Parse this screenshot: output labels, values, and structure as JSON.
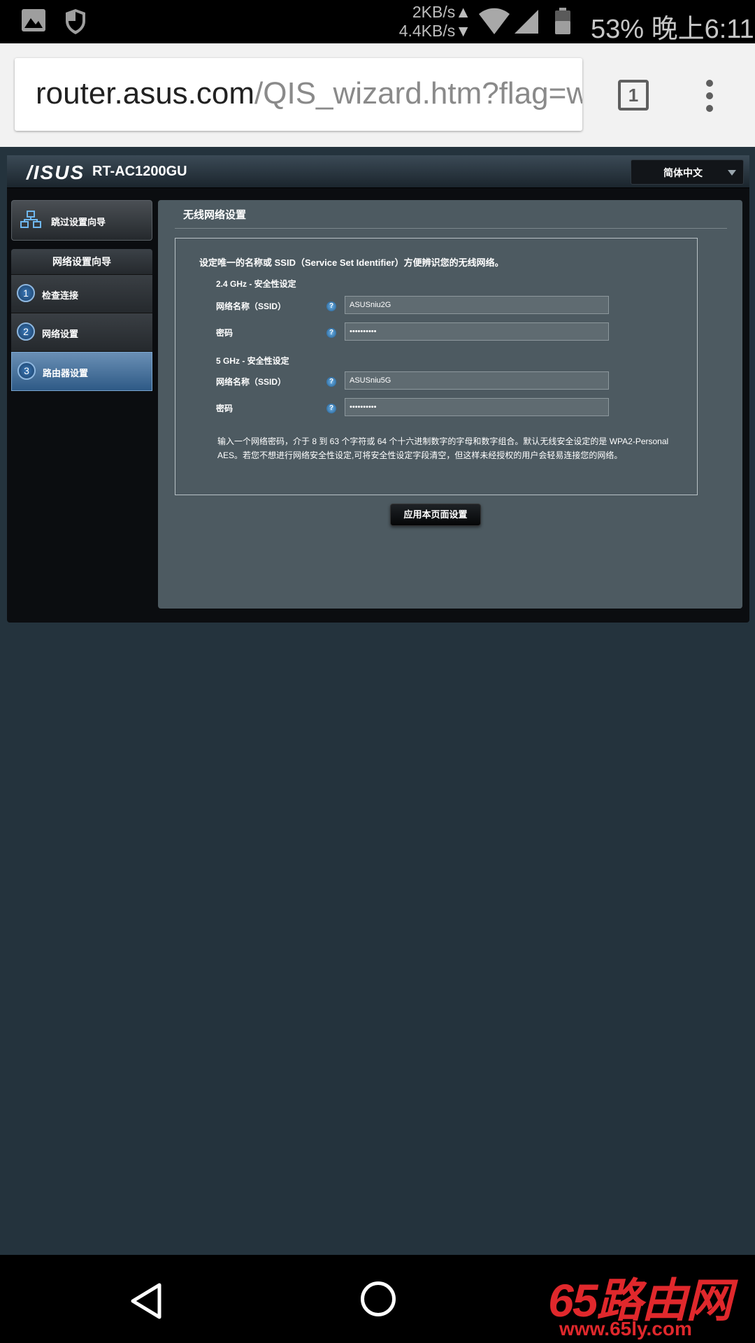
{
  "status_bar": {
    "speed_up": "2KB/s▲",
    "speed_down": "4.4KB/s▼",
    "battery_time": "53% 晚上6:11",
    "icons": [
      "image-icon",
      "shield-icon",
      "wifi-icon",
      "signal-icon",
      "battery-icon"
    ]
  },
  "browser": {
    "url_host": "router.asus.com",
    "url_path": "/QIS_wizard.htm?flag=w",
    "tab_count": "1"
  },
  "router": {
    "brand": "/ISUS",
    "model": "RT-AC1200GU",
    "language": "简体中文",
    "skip_wizard": "跳过设置向导",
    "wizard_title": "网络设置向导",
    "steps": [
      {
        "num": "1",
        "label": "检查连接"
      },
      {
        "num": "2",
        "label": "网络设置"
      },
      {
        "num": "3",
        "label": "路由器设置"
      }
    ],
    "content_title": "无线网络设置",
    "intro": "设定唯一的名称或 SSID（Service Set Identifier）方便辨识您的无线网络。",
    "band_24": {
      "title": "2.4 GHz - 安全性设定",
      "ssid_label": "网络名称（SSID）",
      "ssid_value": "ASUSniu2G",
      "pw_label": "密码",
      "pw_value": "••••••••••"
    },
    "band_5": {
      "title": "5 GHz - 安全性设定",
      "ssid_label": "网络名称（SSID）",
      "ssid_value": "ASUSniu5G",
      "pw_label": "密码",
      "pw_value": "••••••••••"
    },
    "help_glyph": "?",
    "note": "输入一个网络密码，介于 8 到 63 个字符或 64 个十六进制数字的字母和数字组合。默认无线安全设定的是 WPA2-Personal AES。若您不想进行网络安全性设定,可将安全性设定字段清空，但这样未经授权的用户会轻易连接您的网络。",
    "apply_button": "应用本页面设置"
  },
  "watermark": {
    "text": "65路由网",
    "url": "www.65ly.com"
  }
}
